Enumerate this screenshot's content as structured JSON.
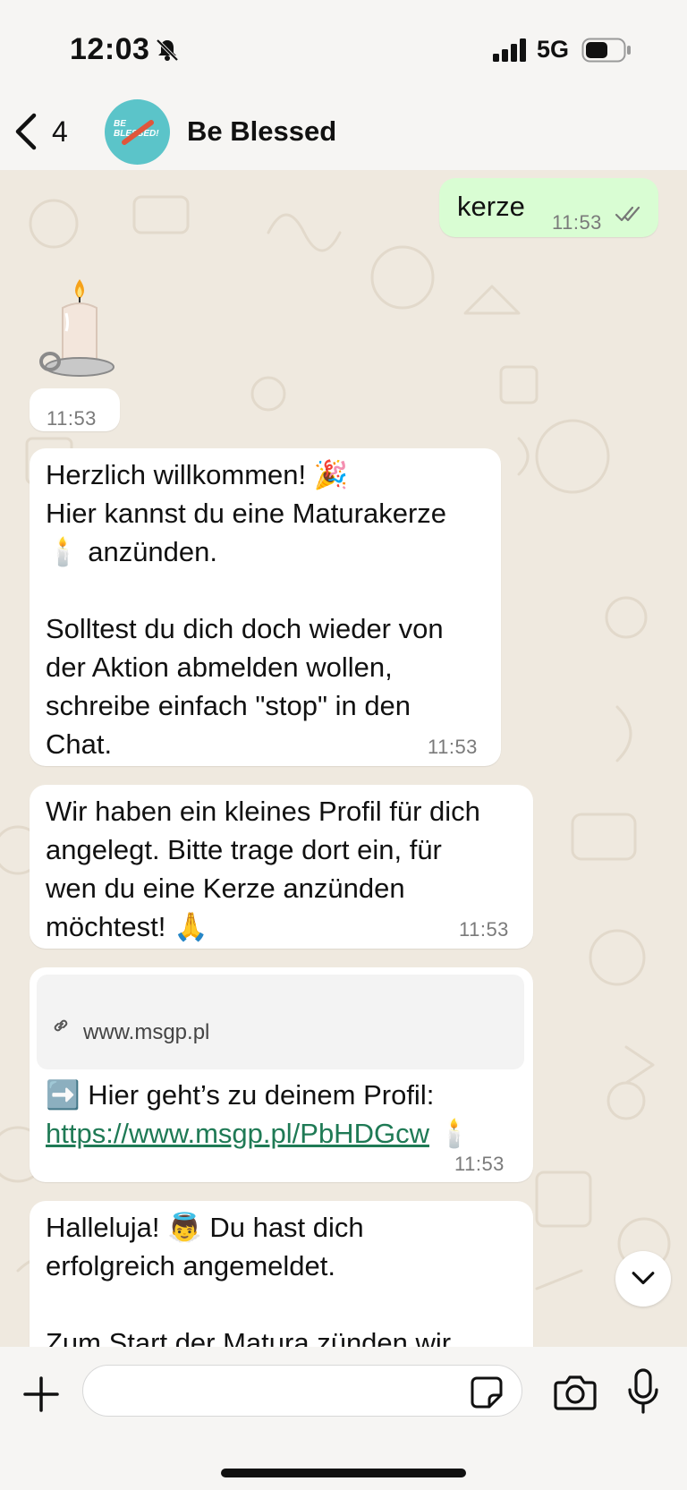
{
  "status_bar": {
    "time": "12:03",
    "network": "5G"
  },
  "header": {
    "back_count": "4",
    "contact_name": "Be Blessed",
    "avatar_text": "BE BLESSED!"
  },
  "messages": [
    {
      "direction": "out",
      "text": "kerze",
      "time": "11:53",
      "status": "read"
    },
    {
      "direction": "in",
      "type": "sticker",
      "sticker": "candle",
      "time": "11:53"
    },
    {
      "direction": "in",
      "lines": [
        "Herzlich willkommen! 🎉",
        "Hier kannst du eine Maturakerze",
        "🕯️ anzünden.",
        "",
        "Solltest du dich doch wieder von",
        "der Aktion abmelden wollen,",
        "schreibe einfach \"stop\" in den",
        "Chat."
      ],
      "time": "11:53"
    },
    {
      "direction": "in",
      "lines": [
        "Wir haben ein kleines Profil für dich",
        "angelegt. Bitte trage dort ein, für",
        "wen du eine Kerze anzünden",
        "möchtest! 🙏"
      ],
      "time": "11:53"
    },
    {
      "direction": "in",
      "preview_url": "www.msgp.pl",
      "text": "➡️ Hier geht’s zu deinem Profil:",
      "link": "https://www.msgp.pl/PbHDGcw",
      "link_suffix": "🕯️",
      "time": "11:53"
    },
    {
      "direction": "in",
      "lines": [
        "Halleluja! 👼 Du hast dich",
        "erfolgreich angemeldet.",
        "",
        "Zum Start der Matura zünden wir"
      ]
    }
  ],
  "input": {
    "placeholder": ""
  },
  "colors": {
    "outgoing_bubble": "#d9fdd3",
    "incoming_bubble": "#ffffff",
    "chat_background": "#efe9df",
    "link": "#1f7a55"
  }
}
